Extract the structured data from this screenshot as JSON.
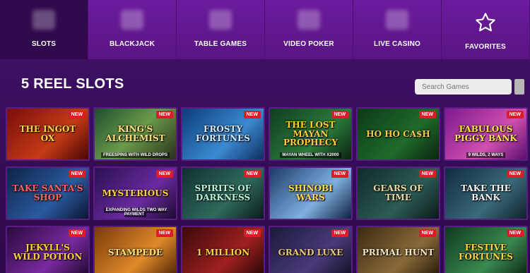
{
  "tabs": [
    {
      "label": "SLOTS",
      "icon": "slot-machine-icon",
      "active": true,
      "width": 125
    },
    {
      "label": "BLACKJACK",
      "icon": "cards-icon",
      "active": false,
      "width": 125
    },
    {
      "label": "TABLE GAMES",
      "icon": "roulette-icon",
      "active": false,
      "width": 125
    },
    {
      "label": "VIDEO POKER",
      "icon": "poker-machine-icon",
      "active": false,
      "width": 125
    },
    {
      "label": "LIVE CASINO",
      "icon": "live-dealer-icon",
      "active": false,
      "width": 125
    },
    {
      "label": "FAVORITES",
      "icon": "star-icon",
      "active": false,
      "width": 125
    }
  ],
  "page_title": "5 REEL SLOTS",
  "search": {
    "placeholder": "Search Games",
    "value": ""
  },
  "colors": {
    "tab_bg": "#6c1b9e",
    "tab_active": "#300a4d",
    "page_bg": "#3a1060",
    "badge": "#d91e2a"
  },
  "games": [
    {
      "title": "THE INGOT OX",
      "subtitle": "",
      "badge": "NEW",
      "bg": "linear-gradient(135deg,#7a0d0d,#c43b14 60%,#4a0505)",
      "color": "#ffd23c"
    },
    {
      "title": "King's Alchemist",
      "subtitle": "FREESPINS WITH WILD DROPS",
      "badge": "NEW",
      "bg": "linear-gradient(135deg,#1d4e2e,#6a9b4a 50%,#2a2f1a)",
      "color": "#ffe07a"
    },
    {
      "title": "FROSTY FORTUNES",
      "subtitle": "",
      "badge": "NEW",
      "bg": "linear-gradient(135deg,#0c3c78,#3b8ad2 60%,#0f2f5e)",
      "color": "#cfe9ff"
    },
    {
      "title": "THE LOST MAYAN PROPHECY",
      "subtitle": "MAYAN WHEEL WITH x2000",
      "badge": "NEW",
      "bg": "linear-gradient(135deg,#0f3d22,#2c7a3a 60%,#0a2212)",
      "color": "#ffcc33"
    },
    {
      "title": "HO HO CA$H",
      "subtitle": "",
      "badge": "NEW",
      "bg": "linear-gradient(135deg,#0d3a17,#1f6b2a 60%,#0a2410)",
      "color": "#f2c94c"
    },
    {
      "title": "Fabulous PIGGY BANK",
      "subtitle": "9 WILDS, 2 WAYS",
      "badge": "NEW",
      "bg": "linear-gradient(135deg,#7b1a8f,#d24fb0 60%,#5a0f6e)",
      "color": "#ffe14a"
    },
    {
      "title": "Take Santa's SHOP",
      "subtitle": "",
      "badge": "NEW",
      "bg": "linear-gradient(135deg,#0d2346,#2b5aa0 60%,#0a1630)",
      "color": "#ff6060"
    },
    {
      "title": "MYSTERIOUS",
      "subtitle": "EXPANDING WILDS TWO WAY PAYMENT",
      "badge": "NEW",
      "bg": "linear-gradient(135deg,#2a1150,#6b2aa0 60%,#1a0a30)",
      "color": "#ffcf3a"
    },
    {
      "title": "SPIRITS OF DARKNESS",
      "subtitle": "",
      "badge": "NEW",
      "bg": "linear-gradient(135deg,#0f3030,#2f6a5c 60%,#0a1a1a)",
      "color": "#b7f0d8"
    },
    {
      "title": "SHINOBI WARS",
      "subtitle": "",
      "badge": "NEW",
      "bg": "linear-gradient(135deg,#1a3a6a,#7fb0e0 60%,#102040)",
      "color": "#ffd84a"
    },
    {
      "title": "GEARS OF TIME",
      "subtitle": "",
      "badge": "NEW",
      "bg": "linear-gradient(135deg,#0f2a2a,#2d5c55 60%,#0a1818)",
      "color": "#e7d7a0"
    },
    {
      "title": "Take the BANK",
      "subtitle": "",
      "badge": "NEW",
      "bg": "linear-gradient(135deg,#0f2a40,#3a6a7a 60%,#10202c)",
      "color": "#f5f5f5"
    },
    {
      "title": "JEKYLL'S WILD POTION",
      "subtitle": "",
      "badge": "NEW",
      "bg": "linear-gradient(135deg,#2a0a3e,#7a2aa0 60%,#1a0628)",
      "color": "#ffcf3a"
    },
    {
      "title": "STAMPEDE",
      "subtitle": "",
      "badge": "NEW",
      "bg": "linear-gradient(135deg,#7a3a0a,#e08a2a 60%,#4a2006)",
      "color": "#ffe17a"
    },
    {
      "title": "1 MILLION",
      "subtitle": "",
      "badge": "NEW",
      "bg": "linear-gradient(135deg,#3a0a0a,#a02020 60%,#200606)",
      "color": "#ffd23c"
    },
    {
      "title": "GRAND LUXE",
      "subtitle": "",
      "badge": "NEW",
      "bg": "linear-gradient(135deg,#1a1a3a,#4a3a7a 60%,#0f0f22)",
      "color": "#e8c870"
    },
    {
      "title": "PRIMAL HUNT",
      "subtitle": "",
      "badge": "NEW",
      "bg": "linear-gradient(135deg,#3a2a10,#8a6a3a 60%,#221808)",
      "color": "#f5e6c0"
    },
    {
      "title": "FESTIVE FORTUNES",
      "subtitle": "",
      "badge": "NEW",
      "bg": "linear-gradient(135deg,#0f3a20,#3a8a50 60%,#0a2212)",
      "color": "#ffd23c"
    }
  ]
}
